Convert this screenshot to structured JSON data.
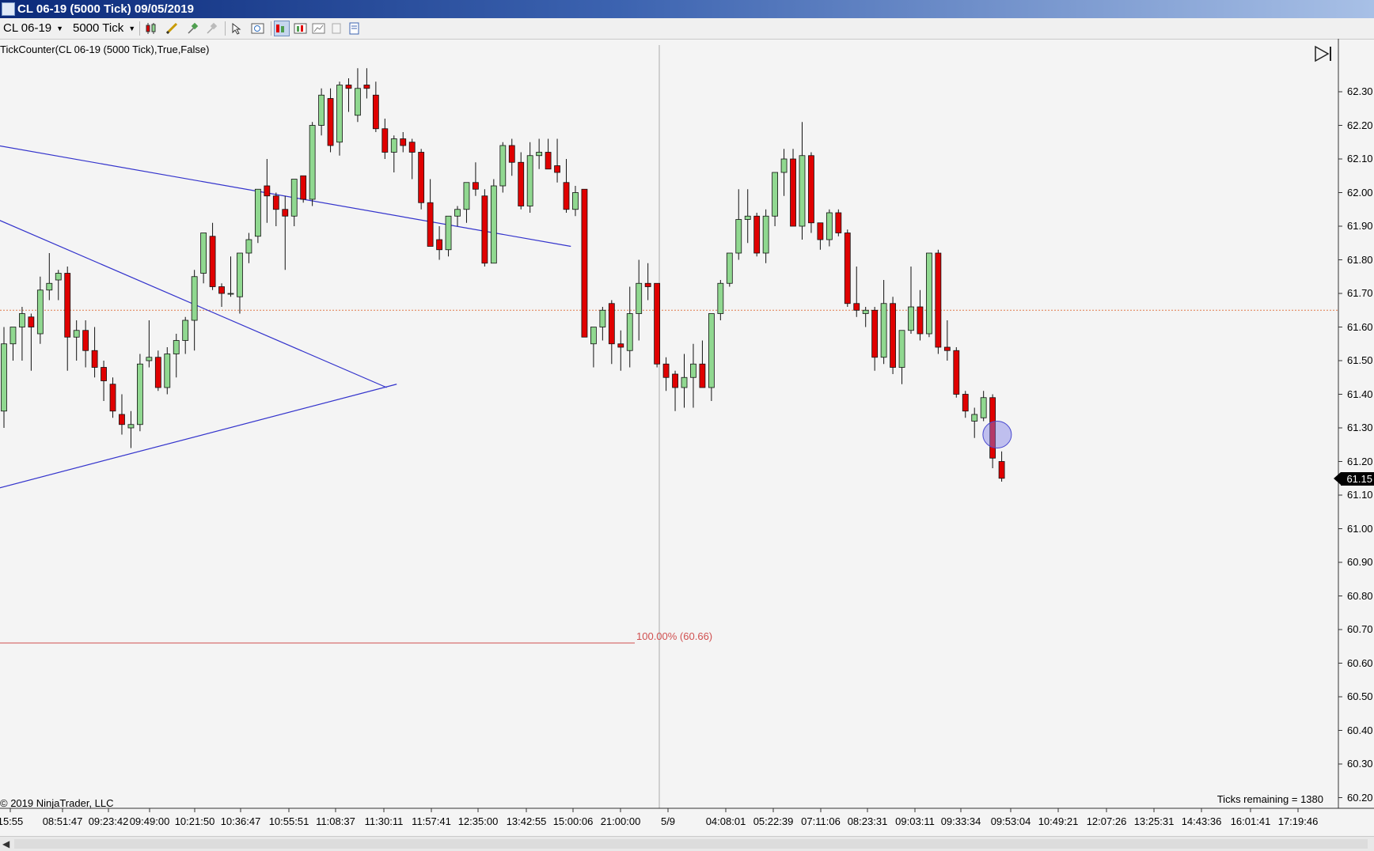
{
  "window": {
    "title": "CL 06-19 (5000 Tick)  09/05/2019"
  },
  "toolbar": {
    "instrument": "CL 06-19",
    "period": "5000 Tick"
  },
  "chart": {
    "indicator_label": "TickCounter(CL 06-19 (5000 Tick),True,False)",
    "copyright": "© 2019 NinjaTrader, LLC",
    "ticks_remaining": "Ticks remaining = 1380",
    "fib_label": "100.00% (60.66)",
    "last_price": "61.15",
    "colors": {
      "up": "#90d890",
      "down": "#e00000",
      "trendline": "#3333cc",
      "fib": "#d05050",
      "background": "#f4f4f4"
    }
  },
  "price_axis": {
    "labels": [
      "62.30",
      "62.20",
      "62.10",
      "62.00",
      "61.90",
      "61.80",
      "61.70",
      "61.60",
      "61.50",
      "61.40",
      "61.30",
      "61.20",
      "61.10",
      "61.00",
      "60.90",
      "60.80",
      "60.70",
      "60.60",
      "60.50",
      "60.40",
      "60.30",
      "60.20"
    ]
  },
  "time_axis": {
    "labels": [
      "15:55",
      "08:51:47",
      "09:23:42",
      "09:49:00",
      "10:21:50",
      "10:36:47",
      "10:55:51",
      "11:08:37",
      "11:30:11",
      "11:57:41",
      "12:35:00",
      "13:42:55",
      "15:00:06",
      "21:00:00",
      "5/9",
      "04:08:01",
      "05:22:39",
      "07:11:06",
      "08:23:31",
      "09:03:11",
      "09:33:34",
      "09:53:04",
      "10:49:21",
      "12:07:26",
      "13:25:31",
      "14:43:36",
      "16:01:41",
      "17:19:46"
    ]
  },
  "chart_data": {
    "type": "candlestick",
    "y_range": [
      60.15,
      62.37
    ],
    "reference_line": 61.65,
    "fib_level": 60.66,
    "candles": [
      {
        "o": 61.35,
        "h": 61.6,
        "l": 61.3,
        "c": 61.55
      },
      {
        "o": 61.55,
        "h": 61.6,
        "l": 61.5,
        "c": 61.6
      },
      {
        "o": 61.6,
        "h": 61.66,
        "l": 61.5,
        "c": 61.64
      },
      {
        "o": 61.63,
        "h": 61.64,
        "l": 61.47,
        "c": 61.6
      },
      {
        "o": 61.58,
        "h": 61.75,
        "l": 61.55,
        "c": 61.71
      },
      {
        "o": 61.71,
        "h": 61.82,
        "l": 61.68,
        "c": 61.73
      },
      {
        "o": 61.74,
        "h": 61.77,
        "l": 61.68,
        "c": 61.76
      },
      {
        "o": 61.76,
        "h": 61.78,
        "l": 61.47,
        "c": 61.57
      },
      {
        "o": 61.57,
        "h": 61.62,
        "l": 61.5,
        "c": 61.59
      },
      {
        "o": 61.59,
        "h": 61.62,
        "l": 61.48,
        "c": 61.53
      },
      {
        "o": 61.53,
        "h": 61.6,
        "l": 61.45,
        "c": 61.48
      },
      {
        "o": 61.48,
        "h": 61.5,
        "l": 61.38,
        "c": 61.44
      },
      {
        "o": 61.43,
        "h": 61.45,
        "l": 61.33,
        "c": 61.35
      },
      {
        "o": 61.34,
        "h": 61.4,
        "l": 61.28,
        "c": 61.31
      },
      {
        "o": 61.3,
        "h": 61.35,
        "l": 61.24,
        "c": 61.31
      },
      {
        "o": 61.31,
        "h": 61.52,
        "l": 61.29,
        "c": 61.49
      },
      {
        "o": 61.5,
        "h": 61.62,
        "l": 61.48,
        "c": 61.51
      },
      {
        "o": 61.51,
        "h": 61.53,
        "l": 61.41,
        "c": 61.42
      },
      {
        "o": 61.42,
        "h": 61.54,
        "l": 61.4,
        "c": 61.52
      },
      {
        "o": 61.52,
        "h": 61.58,
        "l": 61.45,
        "c": 61.56
      },
      {
        "o": 61.56,
        "h": 61.63,
        "l": 61.52,
        "c": 61.62
      },
      {
        "o": 61.62,
        "h": 61.77,
        "l": 61.53,
        "c": 61.75
      },
      {
        "o": 61.76,
        "h": 61.87,
        "l": 61.73,
        "c": 61.88
      },
      {
        "o": 61.87,
        "h": 61.91,
        "l": 61.71,
        "c": 61.72
      },
      {
        "o": 61.72,
        "h": 61.73,
        "l": 61.66,
        "c": 61.7
      },
      {
        "o": 61.7,
        "h": 61.81,
        "l": 61.69,
        "c": 61.7
      },
      {
        "o": 61.69,
        "h": 61.78,
        "l": 61.64,
        "c": 61.82
      },
      {
        "o": 61.82,
        "h": 61.88,
        "l": 61.79,
        "c": 61.86
      },
      {
        "o": 61.87,
        "h": 62.0,
        "l": 61.85,
        "c": 62.01
      },
      {
        "o": 62.02,
        "h": 62.1,
        "l": 61.91,
        "c": 61.99
      },
      {
        "o": 61.99,
        "h": 62.0,
        "l": 61.9,
        "c": 61.95
      },
      {
        "o": 61.95,
        "h": 61.99,
        "l": 61.77,
        "c": 61.93
      },
      {
        "o": 61.93,
        "h": 62.02,
        "l": 61.9,
        "c": 62.04
      },
      {
        "o": 62.05,
        "h": 62.05,
        "l": 61.97,
        "c": 61.98
      },
      {
        "o": 61.98,
        "h": 62.21,
        "l": 61.96,
        "c": 62.2
      },
      {
        "o": 62.2,
        "h": 62.31,
        "l": 62.17,
        "c": 62.29
      },
      {
        "o": 62.28,
        "h": 62.31,
        "l": 62.12,
        "c": 62.14
      },
      {
        "o": 62.15,
        "h": 62.33,
        "l": 62.11,
        "c": 62.32
      },
      {
        "o": 62.32,
        "h": 62.34,
        "l": 62.24,
        "c": 62.31
      },
      {
        "o": 62.23,
        "h": 62.37,
        "l": 62.21,
        "c": 62.31
      },
      {
        "o": 62.32,
        "h": 62.37,
        "l": 62.28,
        "c": 62.31
      },
      {
        "o": 62.29,
        "h": 62.33,
        "l": 62.18,
        "c": 62.19
      },
      {
        "o": 62.19,
        "h": 62.22,
        "l": 62.1,
        "c": 62.12
      },
      {
        "o": 62.12,
        "h": 62.17,
        "l": 62.06,
        "c": 62.16
      },
      {
        "o": 62.16,
        "h": 62.18,
        "l": 62.12,
        "c": 62.14
      },
      {
        "o": 62.15,
        "h": 62.16,
        "l": 62.04,
        "c": 62.12
      },
      {
        "o": 62.12,
        "h": 62.13,
        "l": 61.95,
        "c": 61.97
      },
      {
        "o": 61.97,
        "h": 62.04,
        "l": 61.85,
        "c": 61.84
      },
      {
        "o": 61.86,
        "h": 61.9,
        "l": 61.8,
        "c": 61.83
      },
      {
        "o": 61.83,
        "h": 61.92,
        "l": 61.81,
        "c": 61.93
      },
      {
        "o": 61.93,
        "h": 61.96,
        "l": 61.9,
        "c": 61.95
      },
      {
        "o": 61.95,
        "h": 62.03,
        "l": 61.91,
        "c": 62.03
      },
      {
        "o": 62.03,
        "h": 62.09,
        "l": 61.99,
        "c": 62.01
      },
      {
        "o": 61.99,
        "h": 62.01,
        "l": 61.78,
        "c": 61.79
      },
      {
        "o": 61.79,
        "h": 62.04,
        "l": 61.79,
        "c": 62.02
      },
      {
        "o": 62.02,
        "h": 62.15,
        "l": 62.0,
        "c": 62.14
      },
      {
        "o": 62.14,
        "h": 62.16,
        "l": 62.05,
        "c": 62.09
      },
      {
        "o": 62.09,
        "h": 62.12,
        "l": 61.95,
        "c": 61.96
      },
      {
        "o": 61.96,
        "h": 62.15,
        "l": 61.94,
        "c": 62.11
      },
      {
        "o": 62.11,
        "h": 62.16,
        "l": 62.07,
        "c": 62.12
      },
      {
        "o": 62.12,
        "h": 62.16,
        "l": 62.07,
        "c": 62.07
      },
      {
        "o": 62.08,
        "h": 62.16,
        "l": 62.03,
        "c": 62.06
      },
      {
        "o": 62.03,
        "h": 62.1,
        "l": 61.94,
        "c": 61.95
      },
      {
        "o": 61.95,
        "h": 62.02,
        "l": 61.93,
        "c": 62.0
      },
      {
        "o": 62.01,
        "h": 62.01,
        "l": 61.58,
        "c": 61.57
      },
      {
        "o": 61.55,
        "h": 61.6,
        "l": 61.48,
        "c": 61.6
      },
      {
        "o": 61.6,
        "h": 61.66,
        "l": 61.56,
        "c": 61.65
      },
      {
        "o": 61.67,
        "h": 61.68,
        "l": 61.49,
        "c": 61.55
      },
      {
        "o": 61.55,
        "h": 61.59,
        "l": 61.47,
        "c": 61.54
      },
      {
        "o": 61.53,
        "h": 61.72,
        "l": 61.48,
        "c": 61.64
      },
      {
        "o": 61.64,
        "h": 61.8,
        "l": 61.56,
        "c": 61.73
      },
      {
        "o": 61.73,
        "h": 61.79,
        "l": 61.68,
        "c": 61.72
      },
      {
        "o": 61.73,
        "h": 61.73,
        "l": 61.48,
        "c": 61.49
      },
      {
        "o": 61.49,
        "h": 61.51,
        "l": 61.41,
        "c": 61.45
      },
      {
        "o": 61.46,
        "h": 61.47,
        "l": 61.35,
        "c": 61.42
      },
      {
        "o": 61.42,
        "h": 61.52,
        "l": 61.36,
        "c": 61.45
      },
      {
        "o": 61.45,
        "h": 61.55,
        "l": 61.36,
        "c": 61.49
      },
      {
        "o": 61.49,
        "h": 61.56,
        "l": 61.44,
        "c": 61.42
      },
      {
        "o": 61.42,
        "h": 61.64,
        "l": 61.38,
        "c": 61.64
      },
      {
        "o": 61.64,
        "h": 61.74,
        "l": 61.62,
        "c": 61.73
      },
      {
        "o": 61.73,
        "h": 61.82,
        "l": 61.72,
        "c": 61.82
      },
      {
        "o": 61.82,
        "h": 62.01,
        "l": 61.8,
        "c": 61.92
      },
      {
        "o": 61.92,
        "h": 62.01,
        "l": 61.85,
        "c": 61.93
      },
      {
        "o": 61.93,
        "h": 61.94,
        "l": 61.81,
        "c": 61.82
      },
      {
        "o": 61.82,
        "h": 61.95,
        "l": 61.79,
        "c": 61.93
      },
      {
        "o": 61.93,
        "h": 62.06,
        "l": 61.9,
        "c": 62.06
      },
      {
        "o": 62.06,
        "h": 62.13,
        "l": 61.99,
        "c": 62.1
      },
      {
        "o": 62.1,
        "h": 62.13,
        "l": 61.98,
        "c": 61.9
      },
      {
        "o": 61.9,
        "h": 62.21,
        "l": 61.86,
        "c": 62.11
      },
      {
        "o": 62.11,
        "h": 62.12,
        "l": 61.88,
        "c": 61.91
      },
      {
        "o": 61.91,
        "h": 61.91,
        "l": 61.83,
        "c": 61.86
      },
      {
        "o": 61.86,
        "h": 61.95,
        "l": 61.84,
        "c": 61.94
      },
      {
        "o": 61.94,
        "h": 61.95,
        "l": 61.87,
        "c": 61.88
      },
      {
        "o": 61.88,
        "h": 61.89,
        "l": 61.66,
        "c": 61.67
      },
      {
        "o": 61.67,
        "h": 61.78,
        "l": 61.63,
        "c": 61.65
      },
      {
        "o": 61.64,
        "h": 61.66,
        "l": 61.6,
        "c": 61.65
      },
      {
        "o": 61.65,
        "h": 61.66,
        "l": 61.47,
        "c": 61.51
      },
      {
        "o": 61.51,
        "h": 61.74,
        "l": 61.49,
        "c": 61.67
      },
      {
        "o": 61.67,
        "h": 61.69,
        "l": 61.46,
        "c": 61.48
      },
      {
        "o": 61.48,
        "h": 61.59,
        "l": 61.43,
        "c": 61.59
      },
      {
        "o": 61.59,
        "h": 61.78,
        "l": 61.58,
        "c": 61.66
      },
      {
        "o": 61.66,
        "h": 61.71,
        "l": 61.56,
        "c": 61.58
      },
      {
        "o": 61.58,
        "h": 61.82,
        "l": 61.57,
        "c": 61.82
      },
      {
        "o": 61.82,
        "h": 61.83,
        "l": 61.52,
        "c": 61.54
      },
      {
        "o": 61.54,
        "h": 61.62,
        "l": 61.5,
        "c": 61.53
      },
      {
        "o": 61.53,
        "h": 61.54,
        "l": 61.39,
        "c": 61.4
      },
      {
        "o": 61.4,
        "h": 61.41,
        "l": 61.33,
        "c": 61.35
      },
      {
        "o": 61.32,
        "h": 61.36,
        "l": 61.27,
        "c": 61.34
      },
      {
        "o": 61.33,
        "h": 61.41,
        "l": 61.32,
        "c": 61.39
      },
      {
        "o": 61.39,
        "h": 61.4,
        "l": 61.18,
        "c": 61.21
      },
      {
        "o": 61.2,
        "h": 61.23,
        "l": 61.14,
        "c": 61.15
      }
    ],
    "trendlines": [
      {
        "from": {
          "bar": -0.7,
          "price": 62.14
        },
        "to": {
          "bar": 62.5,
          "price": 61.84
        }
      },
      {
        "from": {
          "bar": -0.7,
          "price": 61.92
        },
        "to": {
          "bar": 42.2,
          "price": 61.42
        }
      },
      {
        "from": {
          "bar": -0.7,
          "price": 61.12
        },
        "to": {
          "bar": 43.3,
          "price": 61.43
        }
      }
    ],
    "marker": {
      "bar": 109.5,
      "price": 61.28
    }
  }
}
